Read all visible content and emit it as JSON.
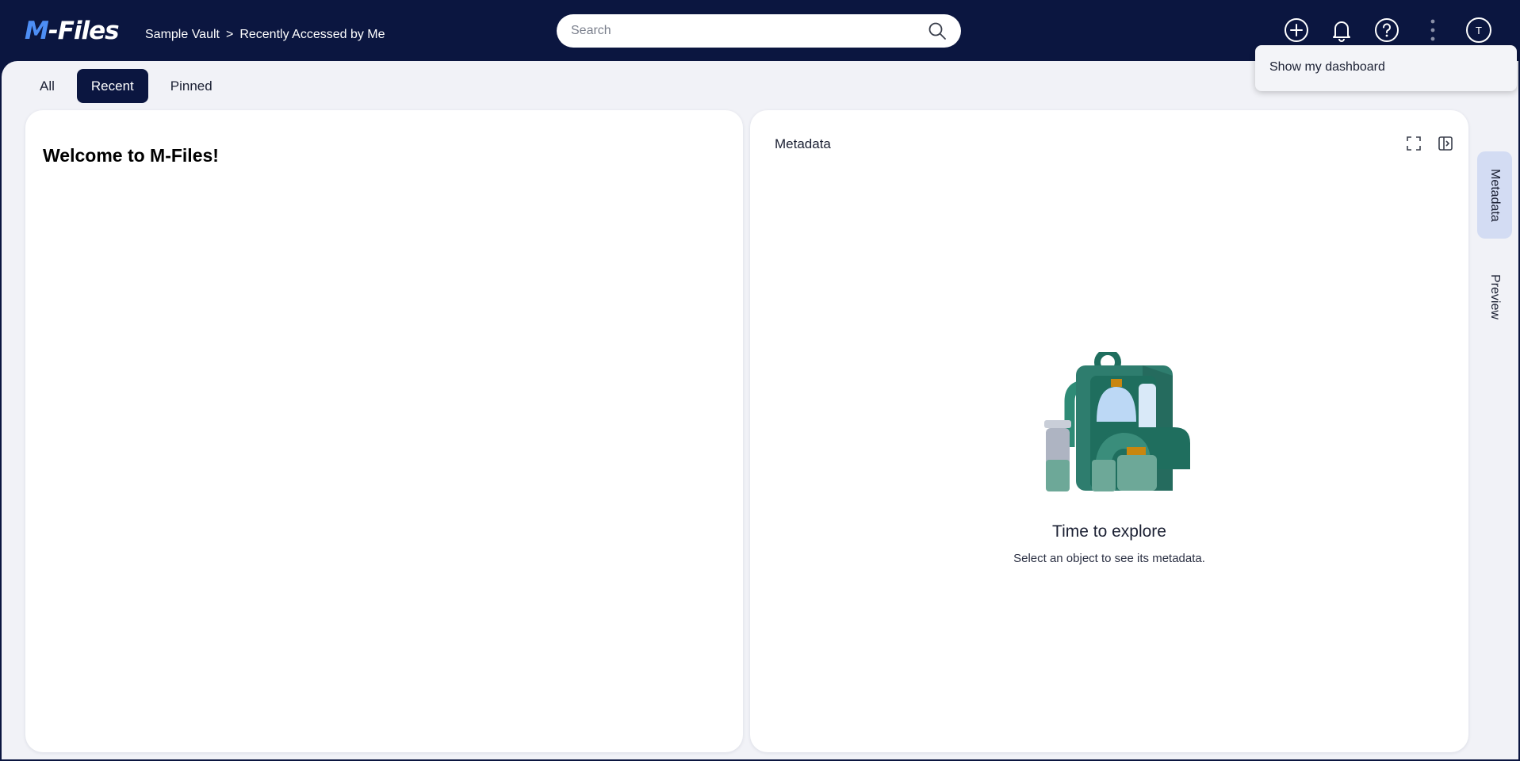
{
  "app": {
    "logo_m": "M",
    "logo_rest": "-Files"
  },
  "breadcrumb": {
    "vault": "Sample Vault",
    "separator": ">",
    "view": "Recently Accessed by Me"
  },
  "search": {
    "placeholder": "Search"
  },
  "header": {
    "icons": [
      "add-icon",
      "bell-icon",
      "help-icon",
      "more-vertical-icon"
    ],
    "avatar_initial": "T"
  },
  "menu": {
    "items": [
      {
        "label": "Show my dashboard"
      }
    ]
  },
  "tabs": [
    {
      "label": "All",
      "active": false
    },
    {
      "label": "Recent",
      "active": true
    },
    {
      "label": "Pinned",
      "active": false
    }
  ],
  "list_panel": {
    "welcome": "Welcome to M-Files!"
  },
  "metadata_panel": {
    "title": "Metadata",
    "empty_title": "Time to explore",
    "empty_subtitle": "Select an object to see its metadata."
  },
  "side_rail": {
    "tabs": [
      {
        "label": "Metadata",
        "active": true
      },
      {
        "label": "Preview",
        "active": false
      }
    ]
  },
  "colors": {
    "header_bg": "#0b1640",
    "accent": "#4d8ef5",
    "page_bg": "#f1f2f7",
    "active_side_tab": "#d3dcf3",
    "illustration_green": "#2e7d6e"
  }
}
